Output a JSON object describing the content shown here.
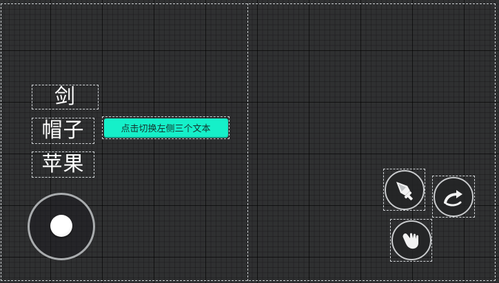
{
  "labels": {
    "item1": "剑",
    "item2": "帽子",
    "item3": "苹果"
  },
  "switch_button": {
    "label": "点击切换左侧三个文本",
    "color": "#15f0c9"
  },
  "controls": {
    "joystick": "virtual-joystick",
    "attack_icon": "sword-icon",
    "jump_icon": "jump-arrow-icon",
    "grab_icon": "hand-icon"
  },
  "colors": {
    "background": "#2f3031",
    "outline": "#cfd3d6"
  }
}
